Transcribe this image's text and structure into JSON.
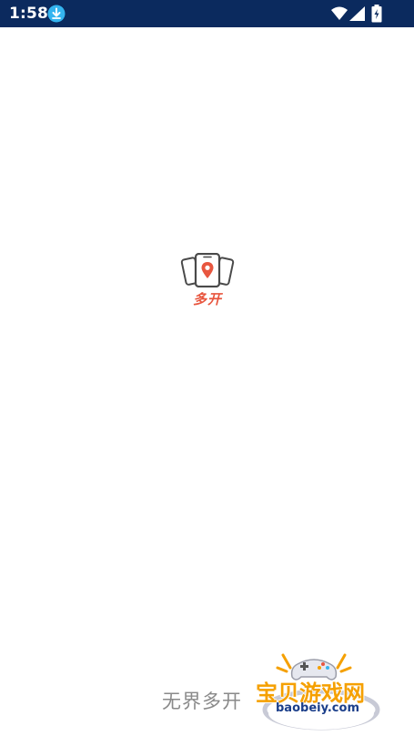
{
  "status_bar": {
    "time": "1:58",
    "background_color": "#0b2a5e",
    "icons": [
      "download-icon",
      "wifi-icon",
      "signal-icon",
      "battery-charging-icon"
    ]
  },
  "logo": {
    "name": "多开",
    "accent_color": "#e8563f",
    "icon": "phones-location-icon"
  },
  "footer": {
    "slogan": "无界多开"
  },
  "watermark": {
    "title": "宝贝游戏网",
    "url": "baobeiy.com",
    "icon": "gamepad-icon"
  }
}
